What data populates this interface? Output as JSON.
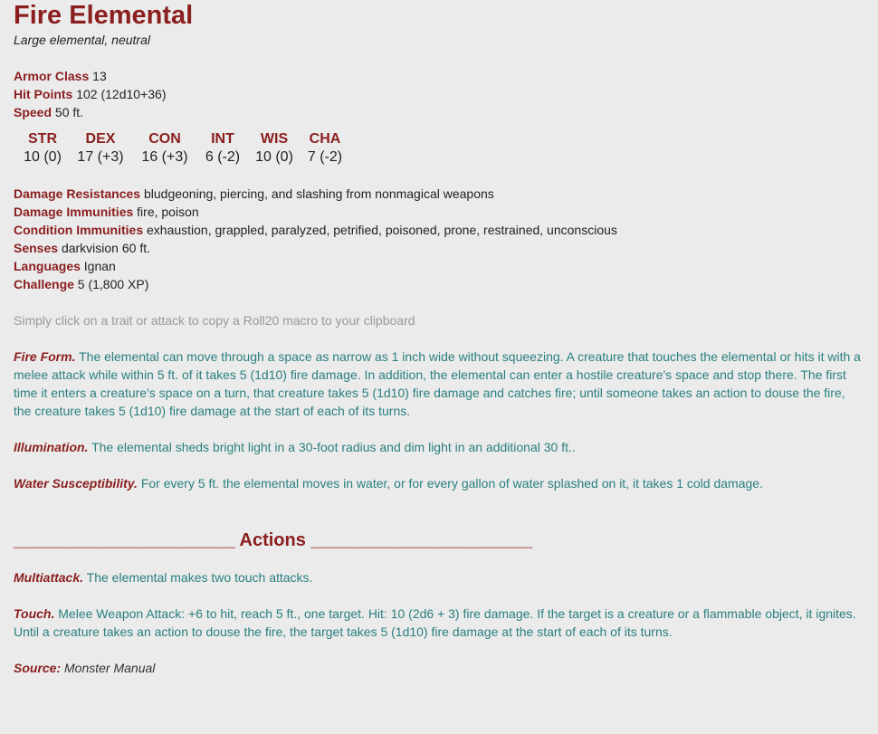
{
  "monster": {
    "name": "Fire Elemental",
    "type_line": "Large elemental, neutral",
    "armor_class": {
      "label": "Armor Class",
      "value": "13"
    },
    "hit_points": {
      "label": "Hit Points",
      "value": "102 (12d10+36)"
    },
    "speed": {
      "label": "Speed",
      "value": "50 ft."
    },
    "abilities": [
      {
        "name": "STR",
        "value": "10 (0)"
      },
      {
        "name": "DEX",
        "value": "17 (+3)"
      },
      {
        "name": "CON",
        "value": "16 (+3)"
      },
      {
        "name": "INT",
        "value": "6 (-2)"
      },
      {
        "name": "WIS",
        "value": "10 (0)"
      },
      {
        "name": "CHA",
        "value": "7 (-2)"
      }
    ],
    "damage_resistances": {
      "label": "Damage Resistances",
      "value": "bludgeoning, piercing, and slashing from nonmagical weapons"
    },
    "damage_immunities": {
      "label": "Damage Immunities",
      "value": "fire, poison"
    },
    "condition_immunities": {
      "label": "Condition Immunities",
      "value": "exhaustion, grappled, paralyzed, petrified, poisoned, prone, restrained, unconscious"
    },
    "senses": {
      "label": "Senses",
      "value": "darkvision 60 ft."
    },
    "languages": {
      "label": "Languages",
      "value": "Ignan"
    },
    "challenge": {
      "label": "Challenge",
      "value": "5 (1,800 XP)"
    }
  },
  "hint": "Simply click on a trait or attack to copy a Roll20 macro to your clipboard",
  "traits": [
    {
      "name": "Fire Form.",
      "text": "The elemental can move through a space as narrow as 1 inch wide without squeezing. A creature that touches the elemental or hits it with a melee attack while within 5 ft. of it takes 5 (1d10) fire damage. In addition, the elemental can enter a hostile creature's space and stop there. The first time it enters a creature's space on a turn, that creature takes 5 (1d10) fire damage and catches fire; until someone takes an action to douse the fire, the creature takes 5 (1d10) fire damage at the start of each of its turns."
    },
    {
      "name": "Illumination.",
      "text": "The elemental sheds bright light in a 30-foot radius and dim light in an additional 30 ft.."
    },
    {
      "name": "Water Susceptibility.",
      "text": "For every 5 ft. the elemental moves in water, or for every gallon of water splashed on it, it takes 1 cold damage."
    }
  ],
  "actions_heading": "______________________ Actions ______________________",
  "actions": [
    {
      "name": "Multiattack.",
      "text": "The elemental makes two touch attacks."
    },
    {
      "name": "Touch.",
      "text": "Melee Weapon Attack: +6 to hit, reach 5 ft., one target. Hit: 10 (2d6 + 3) fire damage. If the target is a creature or a flammable object, it ignites. Until a creature takes an action to douse the fire, the target takes 5 (1d10) fire damage at the start of each of its turns."
    }
  ],
  "source": {
    "label": "Source:",
    "value": "Monster Manual"
  }
}
